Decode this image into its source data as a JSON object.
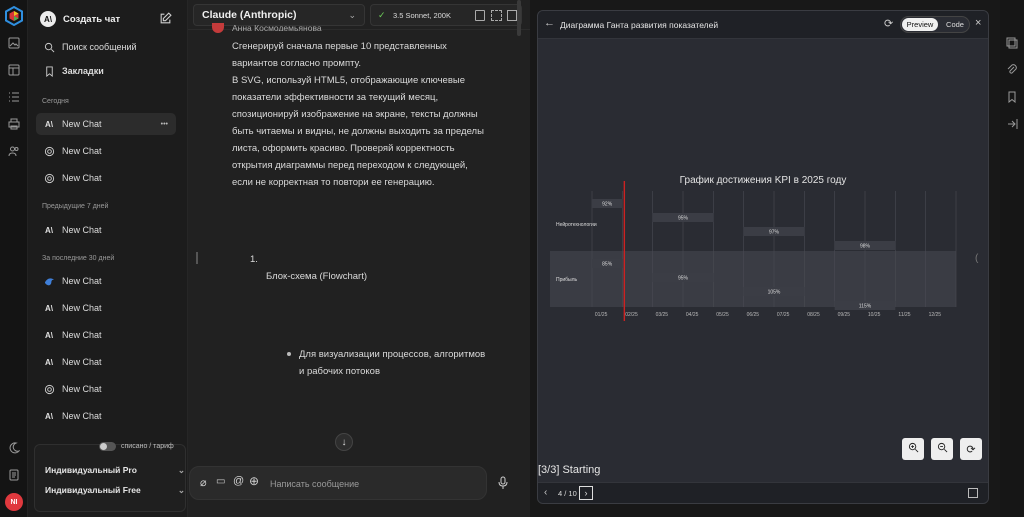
{
  "sidebar": {
    "create_chat": "Создать чат",
    "search": "Поиск сообщений",
    "bookmarks": "Закладки",
    "sections": {
      "today": "Сегодня",
      "prev7": "Предыдущие 7 дней",
      "prev30": "За последние 30 дней"
    },
    "today_items": [
      {
        "label": "New Chat",
        "icon": "anthropic-icon"
      },
      {
        "label": "New Chat",
        "icon": "openai-icon"
      },
      {
        "label": "New Chat",
        "icon": "openai-icon"
      }
    ],
    "prev7_items": [
      {
        "label": "New Chat",
        "icon": "anthropic-icon"
      }
    ],
    "prev30_items": [
      {
        "label": "New Chat",
        "icon": "deepseek-icon"
      },
      {
        "label": "New Chat",
        "icon": "anthropic-icon"
      },
      {
        "label": "New Chat",
        "icon": "anthropic-icon"
      },
      {
        "label": "New Chat",
        "icon": "anthropic-icon"
      },
      {
        "label": "New Chat",
        "icon": "openai-icon"
      },
      {
        "label": "New Chat",
        "icon": "anthropic-icon"
      }
    ],
    "toggle_label": "списано / тариф",
    "plans": [
      "Индивидуальный Pro",
      "Индивидуальный Free"
    ],
    "avatar": "NI",
    "accent": "#e0393e"
  },
  "chat": {
    "model": "Claude (Anthropic)",
    "model_detail": "3.5 Sonnet, 200K",
    "author_partial": "Анна Космодемьянова",
    "message_lines": [
      "Сгенерируй сначала первые 10 представленных",
      "вариантов согласно промпту.",
      "В SVG, используй HTML5, отображающие ключевые",
      "показатели эффективности за текущий месяц,",
      "спозиционируй изображение на экране, тексты должны",
      "быть читаемы и видны, не должны выходить за пределы",
      "листа, оформить красиво. Проверяй корректность",
      "открытия диаграммы перед переходом к следующей,",
      "если не корректная то повтори ее генерацию."
    ],
    "list_number": "1.",
    "list_title": "Блок-схема (Flowchart)",
    "bullet_lines": [
      "Для визуализации процессов, алгоритмов",
      "и рабочих потоков"
    ],
    "input_placeholder": "Написать сообщение"
  },
  "panel": {
    "title": "Диаграмма Ганта развития показателей",
    "tab_preview": "Preview",
    "tab_code": "Code",
    "status": "[3/3] Starting",
    "pager": "4 / 10",
    "bg": "#2a2c33"
  },
  "chart_data": {
    "type": "gantt",
    "title": "График достижения KPI в 2025 году",
    "rows": [
      {
        "name": "Нейротехнологии",
        "bars": [
          {
            "label": "92%",
            "start": "01/25",
            "end": "02/25",
            "lane": 0
          },
          {
            "label": "95%",
            "start": "03/25",
            "end": "05/25",
            "lane": 1
          },
          {
            "label": "97%",
            "start": "06/25",
            "end": "08/25",
            "lane": 2
          },
          {
            "label": "98%",
            "start": "09/25",
            "end": "11/25",
            "lane": 3
          }
        ]
      },
      {
        "name": "Прибыль",
        "bars": [
          {
            "label": "85%",
            "start": "01/25",
            "end": "02/25",
            "lane": 0
          },
          {
            "label": "95%",
            "start": "03/25",
            "end": "05/25",
            "lane": 1
          },
          {
            "label": "105%",
            "start": "06/25",
            "end": "08/25",
            "lane": 2
          },
          {
            "label": "115%",
            "start": "09/25",
            "end": "11/25",
            "lane": 3
          }
        ]
      }
    ],
    "x_ticks": [
      "01/25",
      "02/25",
      "03/25",
      "04/25",
      "05/25",
      "06/25",
      "07/25",
      "08/25",
      "09/25",
      "10/25",
      "11/25",
      "12/25"
    ],
    "current_marker": "02/25",
    "marker_color": "#cc2222",
    "bar_color": "#3b3d45"
  }
}
